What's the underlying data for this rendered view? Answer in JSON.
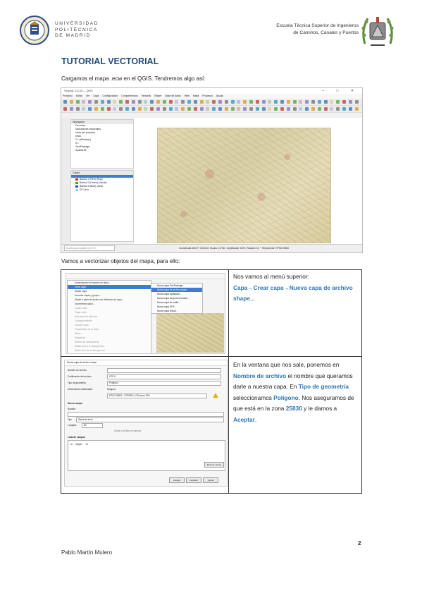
{
  "header": {
    "university_lines": [
      "UNIVERSIDAD",
      "POLITÉCNICA",
      "DE MADRID"
    ],
    "school_lines": [
      "Escuela Técnica Superior de Ingenieros",
      "de Caminos, Canales y Puertos"
    ]
  },
  "title": "TUTORIAL VECTORIAL",
  "intro": "Cargamos el mapa .ecw en el QGIS. Tendremos algo así:",
  "qgis": {
    "window_title": "*sinproj1 3.10.10 — QGIS",
    "menu": [
      "Proyecto",
      "Editar",
      "Ver",
      "Capa",
      "Configuración",
      "Complementos",
      "Vectorial",
      "Ráster",
      "Base de datos",
      "Web",
      "Malla",
      "Procesos",
      "Ayuda"
    ],
    "browser_title": "Navegador",
    "browser_items": [
      "Favoritos",
      "Marcadores espaciales",
      "Inicio del proyecto",
      "Inicio",
      "C:\\ (Windows)",
      "D:\\",
      "GeoPackage",
      "SpatiaLite"
    ],
    "layers_title": "Capas",
    "layers": [
      {
        "label": "Banda 1 (Red) (Rojo)",
        "color": "#d81e1e"
      },
      {
        "label": "Banda 2 (Green) (Verde)",
        "color": "#2fb12f"
      },
      {
        "label": "Banda 3 (Blue) (Azul)",
        "color": "#2a3fd6"
      },
      {
        "label": "El Corvo",
        "color": "#9ad0e8"
      }
    ],
    "status": {
      "search_placeholder": "Escriba para localizar (Ctrl+K)",
      "coordinate_label": "Coordenada",
      "coordinate": "460177  4513104",
      "scale_label": "Escala",
      "scale": "1:17513",
      "magnifier_label": "Amplificador",
      "magnifier": "100%",
      "rotation_label": "Rotación",
      "rotation": "0,0 °",
      "render_label": "Representar",
      "epsg": "EPSG:25830"
    }
  },
  "intro2": "Vamos a vectorizar objetos del mapa, para ello:",
  "step1": {
    "menu_items": [
      "Administrador de fuentes de datos",
      "Crear capa",
      "Añadir capa",
      "Incrustar capas y grupos...",
      "Añadir a partir de archivo de definición de capa...",
      "Georreferenciador...",
      "Copiar estilo",
      "Pegar estilo",
      "Abrir tabla de atributos",
      "Conmutar edición",
      "Guardar capa",
      "Propiedades de la capa...",
      "Filtrar...",
      "Etiquetado",
      "Mostrar en vista general",
      "Añadir todo a la vista general",
      "Quitar todo de la vista general"
    ],
    "submenu_items": [
      "Nueva capa GeoPackage...",
      "Nueva capa de archivo shape...",
      "Nueva capa SpatiaLite...",
      "Nueva capa temporal borrador...",
      "Nueva capa de malla...",
      "Nueva capa GPX...",
      "Nueva capa virtual..."
    ],
    "text_intro": "Nos vamos al menú superior:",
    "path": [
      "Capa",
      "Crear capa",
      "Nueva capa de archivo shape"
    ],
    "arrow": "→",
    "ellipsis": "..."
  },
  "step2": {
    "dialog_title": "Nueva capa de archivo shape",
    "fields": [
      {
        "label": "Nombre de archivo",
        "value": ""
      },
      {
        "label": "Codificación del archivo",
        "value": "UTF-8"
      },
      {
        "label": "Tipo de geometría",
        "value": "Polígono"
      },
      {
        "label": "Dimensiones adicionales",
        "value": "Ninguna"
      }
    ],
    "crs": "EPSG:25830 - ETRS89 / UTM zone 30N",
    "new_field_header": "Nuevo campo",
    "name_label": "Nombre",
    "type_label": "Tipo",
    "type_value": "Datos de texto",
    "length_label": "Longitud",
    "length_value": "80",
    "add_button": "Añadir a la lista de campos",
    "list_header": "Lista de campos",
    "list_row": [
      "id",
      "Integer",
      "10"
    ],
    "remove_button": "Eliminar campo",
    "buttons": [
      "Aceptar",
      "Cancelar",
      "Ayuda"
    ],
    "text_parts": [
      {
        "t": "En la ventana que nos sale, ponemos en ",
        "hl": false
      },
      {
        "t": "Nombre de archivo",
        "hl": true
      },
      {
        "t": " el nombre que queramos darle a nuestra capa. En ",
        "hl": false
      },
      {
        "t": "Tipo de geometría",
        "hl": true
      },
      {
        "t": " seleccionamos ",
        "hl": false
      },
      {
        "t": "Polígono",
        "hl": true
      },
      {
        "t": ". Nos aseguramos de que está en la zona ",
        "hl": false
      },
      {
        "t": "25830",
        "hl": true
      },
      {
        "t": " y le damos a ",
        "hl": false
      },
      {
        "t": "Aceptar",
        "hl": true
      },
      {
        "t": ".",
        "hl": false
      }
    ]
  },
  "page_number": "2",
  "author": "Pablo Martín Mulero",
  "colors": {
    "heading": "#1f4e79",
    "highlight": "#2e75b6",
    "menu_select": "#3d7bd4"
  }
}
